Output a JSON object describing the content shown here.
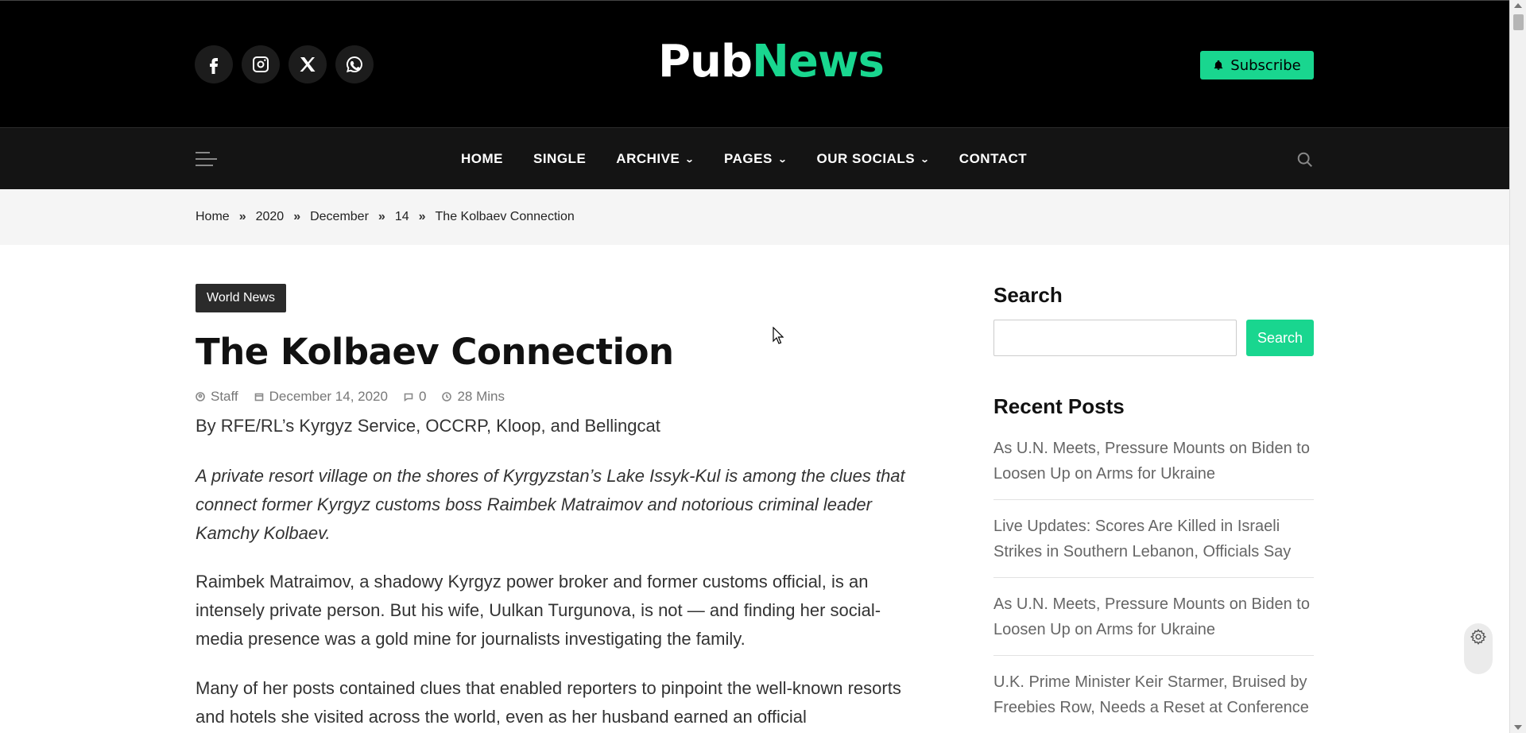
{
  "header": {
    "logo_part1": "Pub",
    "logo_part2": "News",
    "subscribe_label": "Subscribe",
    "socials": [
      "facebook-icon",
      "instagram-icon",
      "x-icon",
      "whatsapp-icon"
    ]
  },
  "nav": {
    "items": [
      {
        "label": "HOME",
        "dropdown": false
      },
      {
        "label": "SINGLE",
        "dropdown": false
      },
      {
        "label": "ARCHIVE",
        "dropdown": true
      },
      {
        "label": "PAGES",
        "dropdown": true
      },
      {
        "label": "OUR SOCIALS",
        "dropdown": true
      },
      {
        "label": "CONTACT",
        "dropdown": false
      }
    ]
  },
  "breadcrumb": [
    "Home",
    "2020",
    "December",
    "14",
    "The Kolbaev Connection"
  ],
  "article": {
    "category": "World News",
    "title": "The Kolbaev Connection",
    "author": "Staff",
    "date": "December 14, 2020",
    "comments": "0",
    "read_time": "28 Mins",
    "byline": "By RFE/RL’s Kyrgyz Service, OCCRP, Kloop, and Bellingcat",
    "lead": "A private resort village on the shores of Kyrgyzstan’s Lake Issyk-Kul is among the clues that connect former Kyrgyz customs boss Raimbek Matraimov and notorious criminal leader Kamchy Kolbaev.",
    "paragraphs": [
      "Raimbek Matraimov, a shadowy Kyrgyz power broker and former customs official, is an intensely private person. But his wife, Uulkan Turgunova, is not — and finding her social-media presence was a gold mine for journalists investigating the family.",
      "Many of her posts contained clues that enabled reporters to pinpoint the well-known resorts and hotels she visited across the world, even as her husband earned an official"
    ]
  },
  "sidebar": {
    "search_heading": "Search",
    "search_placeholder": "",
    "search_button": "Search",
    "recent_heading": "Recent Posts",
    "recent_posts": [
      "As U.N. Meets, Pressure Mounts on Biden to Loosen Up on Arms for Ukraine",
      "Live Updates: Scores Are Killed in Israeli Strikes in Southern Lebanon, Officials Say",
      "As U.N. Meets, Pressure Mounts on Biden to Loosen Up on Arms for Ukraine",
      "U.K. Prime Minister Keir Starmer, Bruised by Freebies Row, Needs a Reset at Conference"
    ]
  },
  "colors": {
    "accent": "#19d68f",
    "header_bg": "#000000",
    "nav_bg": "#141414"
  }
}
